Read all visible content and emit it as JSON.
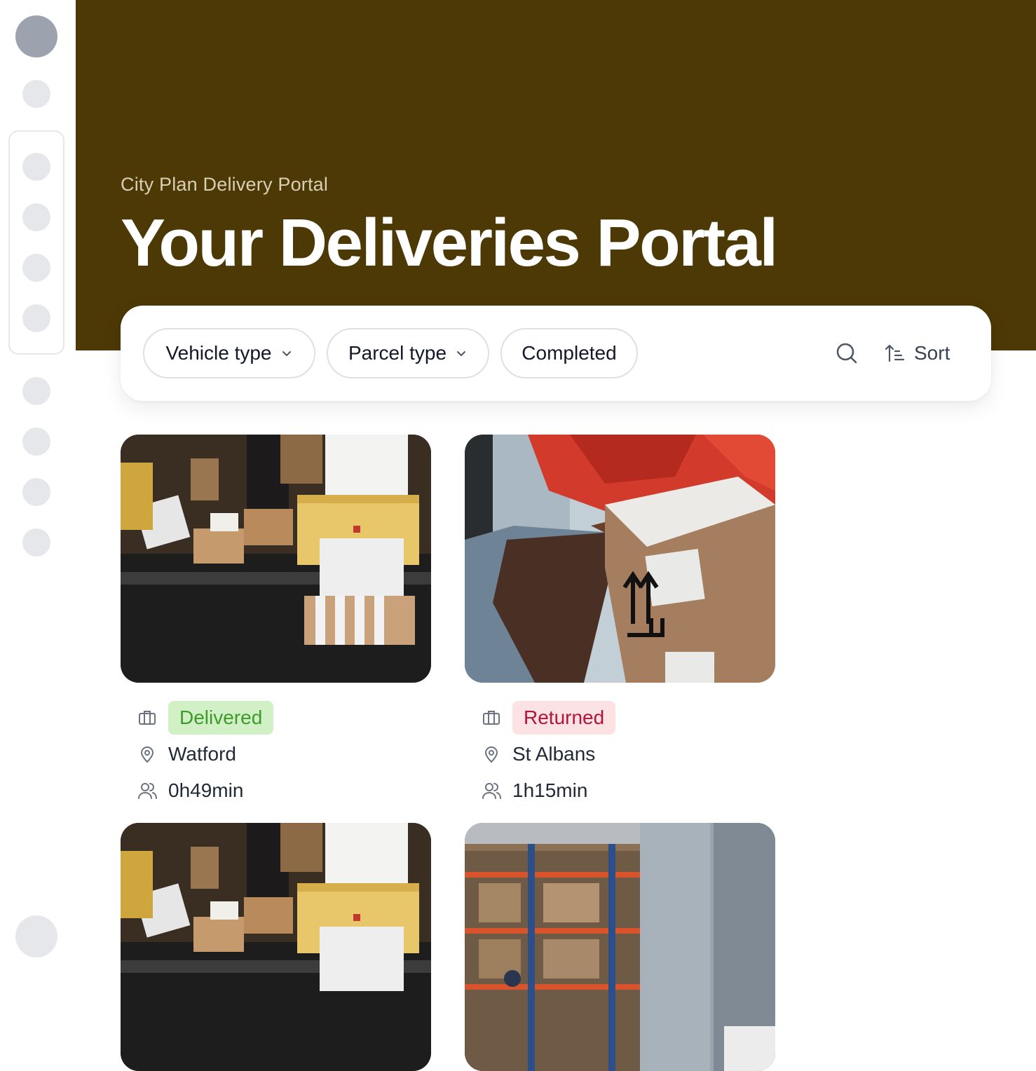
{
  "sidebar": {
    "items": [
      "avatar",
      "nav-1",
      "nav-2",
      "nav-3",
      "nav-4",
      "nav-5",
      "nav-6",
      "nav-7",
      "nav-8",
      "nav-9",
      "nav-bottom"
    ]
  },
  "hero": {
    "subtitle": "City Plan Delivery Portal",
    "title": "Your Deliveries Portal",
    "background": "#4d3906"
  },
  "filters": {
    "vehicle_type": "Vehicle type",
    "parcel_type": "Parcel type",
    "completed": "Completed",
    "sort": "Sort"
  },
  "deliveries": [
    {
      "status": "Delivered",
      "location": "Watford",
      "duration": "0h49min",
      "image": "van-parcels"
    },
    {
      "status": "Returned",
      "location": "St Albans",
      "duration": "1h15min",
      "image": "parcel-handover"
    },
    {
      "image": "van-parcels"
    },
    {
      "image": "warehouse-worker"
    }
  ],
  "colors": {
    "delivered_bg": "#d1f0c5",
    "delivered_text": "#3e9b2b",
    "returned_bg": "#fde2e4",
    "returned_text": "#b3143a"
  }
}
